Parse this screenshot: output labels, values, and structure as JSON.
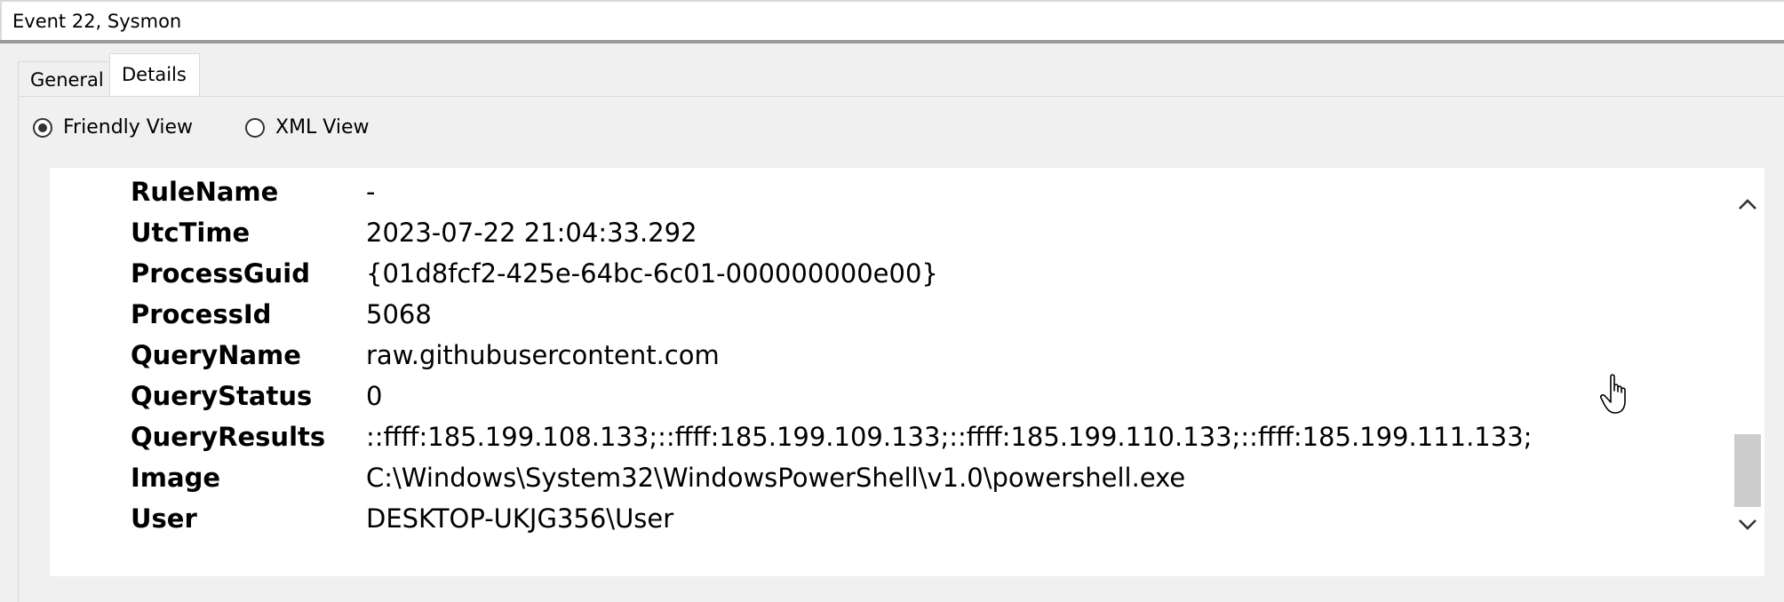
{
  "window": {
    "title": "Event 22, Sysmon"
  },
  "tabs": [
    {
      "label": "General",
      "selected": false
    },
    {
      "label": "Details",
      "selected": true
    }
  ],
  "view_options": {
    "friendly_label": "Friendly View",
    "xml_label": "XML View",
    "selected": "Friendly View"
  },
  "event_data": [
    {
      "name": "RuleName",
      "value": "-"
    },
    {
      "name": "UtcTime",
      "value": "2023-07-22 21:04:33.292"
    },
    {
      "name": "ProcessGuid",
      "value": "{01d8fcf2-425e-64bc-6c01-000000000e00}"
    },
    {
      "name": "ProcessId",
      "value": "5068"
    },
    {
      "name": "QueryName",
      "value": "raw.githubusercontent.com"
    },
    {
      "name": "QueryStatus",
      "value": "0"
    },
    {
      "name": "QueryResults",
      "value": "::ffff:185.199.108.133;::ffff:185.199.109.133;::ffff:185.199.110.133;::ffff:185.199.111.133;"
    },
    {
      "name": "Image",
      "value": "C:\\Windows\\System32\\WindowsPowerShell\\v1.0\\powershell.exe"
    },
    {
      "name": "User",
      "value": "DESKTOP-UKJG356\\User"
    }
  ],
  "icons": {
    "scroll_up": "chevron-up-icon",
    "scroll_down": "chevron-down-icon",
    "cursor": "hand-pointer-icon"
  }
}
